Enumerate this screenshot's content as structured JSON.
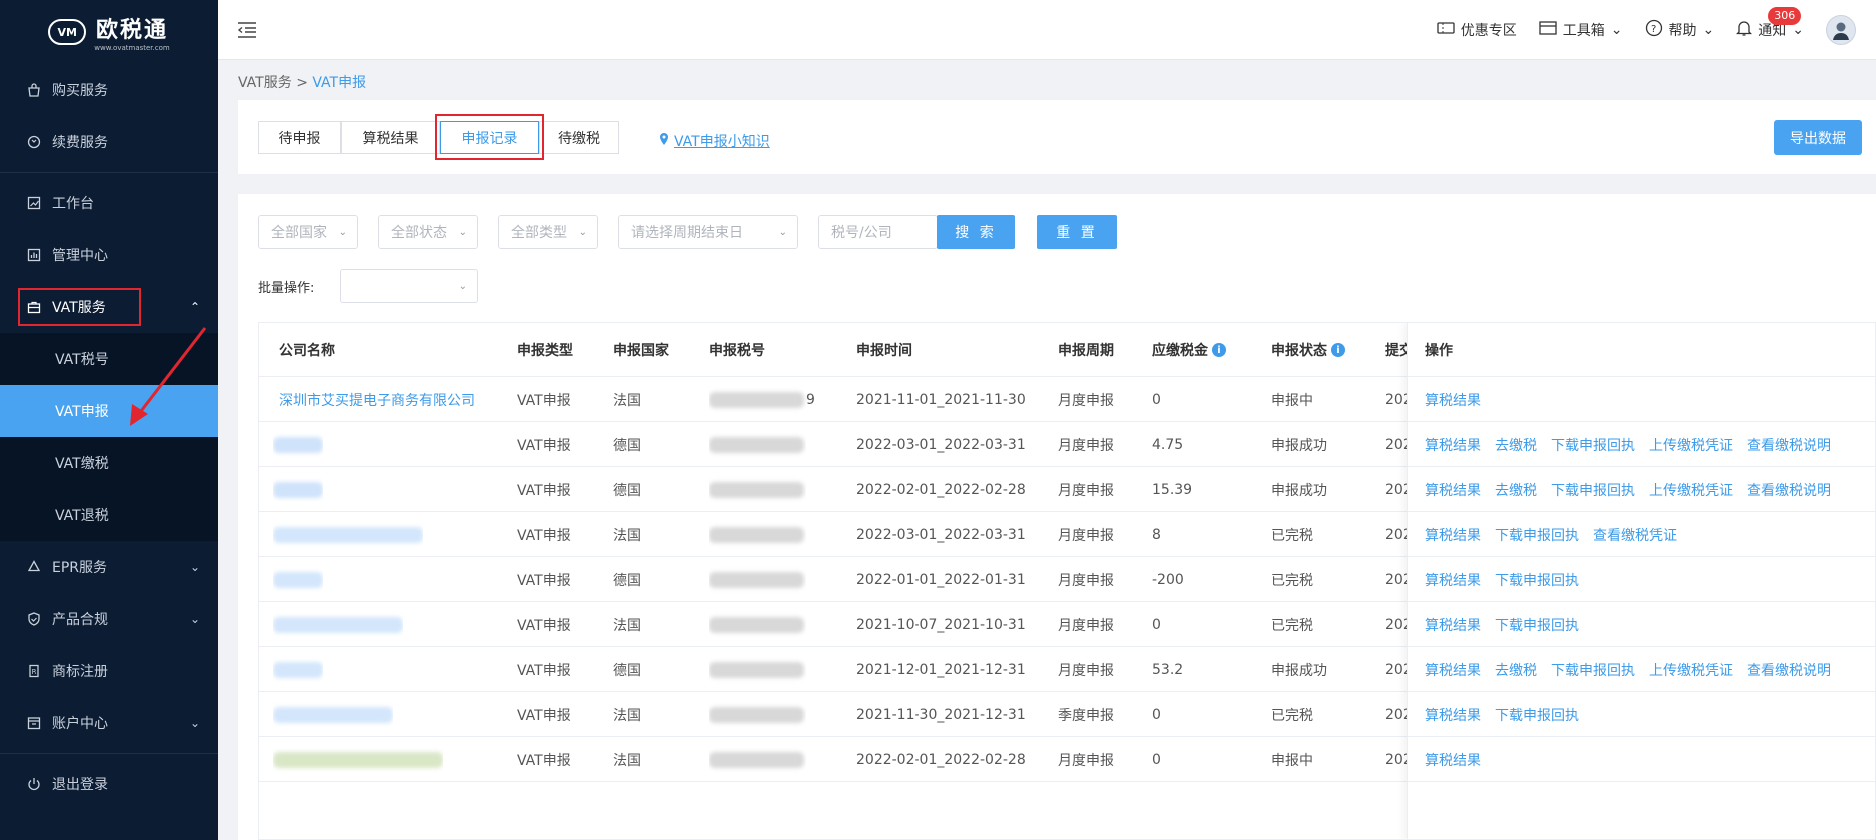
{
  "brand": {
    "logo_mark": "VM",
    "name": "欧税通",
    "sub": "www.ovatmaster.com"
  },
  "sidebar": {
    "top_items": [
      {
        "label": "购买服务",
        "icon": "bag-icon"
      },
      {
        "label": "续费服务",
        "icon": "renew-icon"
      }
    ],
    "mid_items": [
      {
        "label": "工作台",
        "icon": "chart-icon"
      },
      {
        "label": "管理中心",
        "icon": "bar-chart-icon"
      }
    ],
    "vat_group": {
      "label": "VAT服务",
      "icon": "briefcase-icon",
      "children": [
        "VAT税号",
        "VAT申报",
        "VAT缴税",
        "VAT退税"
      ]
    },
    "bottom_items": [
      {
        "label": "EPR服务",
        "icon": "recycle-icon"
      },
      {
        "label": "产品合规",
        "icon": "shield-icon"
      },
      {
        "label": "商标注册",
        "icon": "trademark-icon"
      },
      {
        "label": "账户中心",
        "icon": "account-icon"
      }
    ],
    "logout": "退出登录"
  },
  "topbar": {
    "coupon": "优惠专区",
    "toolbox": "工具箱",
    "help": "帮助",
    "notice": "通知",
    "notice_count": "306"
  },
  "breadcrumb": {
    "parent": "VAT服务",
    "sep": ">",
    "current": "VAT申报"
  },
  "tabs": [
    "待申报",
    "算税结果",
    "申报记录",
    "待缴税"
  ],
  "tip_link": "VAT申报小知识",
  "export_label": "导出数据",
  "filters": {
    "country": "全部国家",
    "status": "全部状态",
    "type": "全部类型",
    "period_end": "请选择周期结束日",
    "search_placeholder": "税号/公司",
    "search_btn": "搜 索",
    "reset_btn": "重 置",
    "batch_label": "批量操作:"
  },
  "table": {
    "headers": [
      "公司名称",
      "申报类型",
      "申报国家",
      "申报税号",
      "申报时间",
      "申报周期",
      "应缴税金",
      "申报状态",
      "提交",
      "操作"
    ],
    "rows": [
      {
        "company": "深圳市艾买提电子商务有限公司",
        "type": "VAT申报",
        "country": "法国",
        "tax_suffix": "9",
        "time": "2021-11-01_2021-11-30",
        "period": "月度申报",
        "amount": "0",
        "status": "申报中",
        "submit": "202",
        "ops": [
          "算税结果"
        ]
      },
      {
        "company": "",
        "type": "VAT申报",
        "country": "德国",
        "tax_suffix": "",
        "time": "2022-03-01_2022-03-31",
        "period": "月度申报",
        "amount": "4.75",
        "status": "申报成功",
        "submit": "202",
        "ops": [
          "算税结果",
          "去缴税",
          "下载申报回执",
          "上传缴税凭证",
          "查看缴税说明"
        ]
      },
      {
        "company": "",
        "type": "VAT申报",
        "country": "德国",
        "tax_suffix": "",
        "time": "2022-02-01_2022-02-28",
        "period": "月度申报",
        "amount": "15.39",
        "status": "申报成功",
        "submit": "202",
        "ops": [
          "算税结果",
          "去缴税",
          "下载申报回执",
          "上传缴税凭证",
          "查看缴税说明"
        ]
      },
      {
        "company": "",
        "type": "VAT申报",
        "country": "法国",
        "tax_suffix": "",
        "time": "2022-03-01_2022-03-31",
        "period": "月度申报",
        "amount": "8",
        "status": "已完税",
        "submit": "202",
        "ops": [
          "算税结果",
          "下载申报回执",
          "查看缴税凭证"
        ]
      },
      {
        "company": "",
        "type": "VAT申报",
        "country": "德国",
        "tax_suffix": "",
        "time": "2022-01-01_2022-01-31",
        "period": "月度申报",
        "amount": "-200",
        "status": "已完税",
        "submit": "202",
        "ops": [
          "算税结果",
          "下载申报回执"
        ]
      },
      {
        "company": "",
        "type": "VAT申报",
        "country": "法国",
        "tax_suffix": "",
        "time": "2021-10-07_2021-10-31",
        "period": "月度申报",
        "amount": "0",
        "status": "已完税",
        "submit": "202",
        "ops": [
          "算税结果",
          "下载申报回执"
        ]
      },
      {
        "company": "",
        "type": "VAT申报",
        "country": "德国",
        "tax_suffix": "",
        "time": "2021-12-01_2021-12-31",
        "period": "月度申报",
        "amount": "53.2",
        "status": "申报成功",
        "submit": "202",
        "ops": [
          "算税结果",
          "去缴税",
          "下载申报回执",
          "上传缴税凭证",
          "查看缴税说明"
        ]
      },
      {
        "company": "",
        "type": "VAT申报",
        "country": "法国",
        "tax_suffix": "",
        "time": "2021-11-30_2021-12-31",
        "period": "季度申报",
        "amount": "0",
        "status": "已完税",
        "submit": "202",
        "ops": [
          "算税结果",
          "下载申报回执"
        ]
      },
      {
        "company": "",
        "type": "VAT申报",
        "country": "法国",
        "tax_suffix": "",
        "time": "2022-02-01_2022-02-28",
        "period": "月度申报",
        "amount": "0",
        "status": "申报中",
        "submit": "202",
        "ops": [
          "算税结果"
        ]
      }
    ]
  }
}
